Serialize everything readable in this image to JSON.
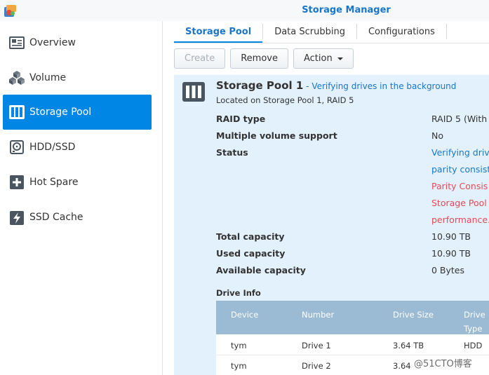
{
  "window": {
    "title": "Storage Manager"
  },
  "sidebar": {
    "items": [
      {
        "label": "Overview",
        "active": false
      },
      {
        "label": "Volume",
        "active": false
      },
      {
        "label": "Storage Pool",
        "active": true
      },
      {
        "label": "HDD/SSD",
        "active": false
      },
      {
        "label": "Hot Spare",
        "active": false
      },
      {
        "label": "SSD Cache",
        "active": false
      }
    ]
  },
  "tabs": [
    {
      "label": "Storage Pool",
      "active": true
    },
    {
      "label": "Data Scrubbing",
      "active": false
    },
    {
      "label": "Configurations",
      "active": false
    }
  ],
  "toolbar": {
    "create_label": "Create",
    "remove_label": "Remove",
    "action_label": "Action"
  },
  "pool": {
    "name": "Storage Pool 1",
    "status_sep": " - ",
    "status": "Verifying drives in the background",
    "location": "Located on Storage Pool 1, RAID 5",
    "properties": {
      "raid_type_label": "RAID type",
      "raid_type_value": "RAID 5 (With",
      "multi_volume_label": "Multiple volume support",
      "multi_volume_value": "No",
      "status_label": "Status",
      "status_lines": [
        "Verifying drive",
        "parity consist",
        "Parity Consis",
        "Storage Pool",
        "performance."
      ],
      "total_capacity_label": "Total capacity",
      "total_capacity_value": "10.90 TB",
      "used_capacity_label": "Used capacity",
      "used_capacity_value": "10.90 TB",
      "available_capacity_label": "Available capacity",
      "available_capacity_value": "0 Bytes"
    },
    "drive_info": {
      "title": "Drive Info",
      "headers": {
        "device": "Device",
        "number": "Number",
        "size": "Drive Size",
        "type_line1": "Drive",
        "type_line2": "Type"
      },
      "rows": [
        {
          "device": "tym",
          "number": "Drive 1",
          "size": "3.64 TB",
          "type": "HDD"
        },
        {
          "device": "tym",
          "number": "Drive 2",
          "size": "3.64",
          "type": ""
        }
      ]
    }
  },
  "watermark": "@51CTO博客",
  "colors": {
    "accent": "#0086e5",
    "link": "#1a76c7",
    "warning": "#e34a57",
    "panel_bg": "#e3f1fc",
    "table_header": "#9bbad3"
  }
}
